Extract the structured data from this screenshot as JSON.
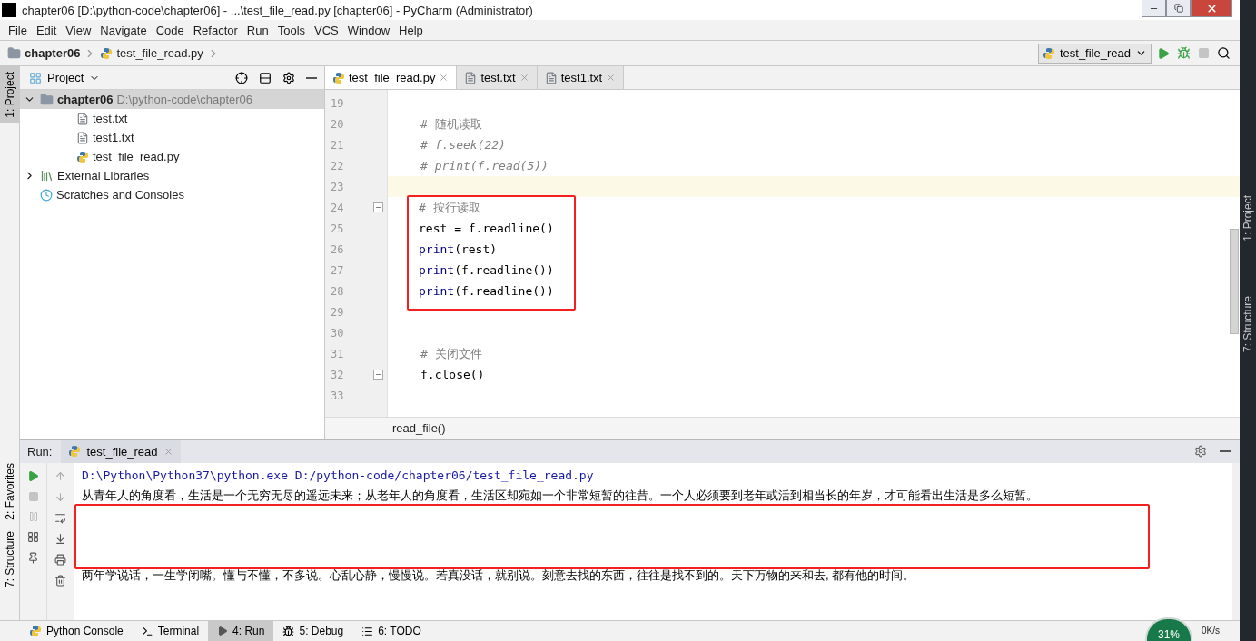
{
  "window": {
    "title": "chapter06 [D:\\python-code\\chapter06] - ...\\test_file_read.py [chapter06] - PyCharm (Administrator)"
  },
  "menu": [
    "File",
    "Edit",
    "View",
    "Navigate",
    "Code",
    "Refactor",
    "Run",
    "Tools",
    "VCS",
    "Window",
    "Help"
  ],
  "breadcrumb": {
    "folder": "chapter06",
    "file": "test_file_read.py"
  },
  "run_config": {
    "name": "test_file_read"
  },
  "left_tool_tabs": [
    {
      "label": "1: Project",
      "selected": true
    },
    {
      "label": "2: Favorites",
      "selected": false
    },
    {
      "label": "7: Structure",
      "selected": false
    }
  ],
  "project": {
    "title": "Project",
    "tree": [
      {
        "name": "chapter06",
        "path": "D:\\python-code\\chapter06",
        "kind": "folder",
        "expanded": true,
        "selected": true,
        "children": [
          {
            "name": "test.txt",
            "kind": "text",
            "selected": false
          },
          {
            "name": "test1.txt",
            "kind": "text",
            "selected": false
          },
          {
            "name": "test_file_read.py",
            "kind": "python",
            "selected": false
          }
        ]
      },
      {
        "name": "External Libraries",
        "kind": "library",
        "expanded": false,
        "selected": false
      },
      {
        "name": "Scratches and Consoles",
        "kind": "scratch",
        "selected": false
      }
    ]
  },
  "editor": {
    "tabs": [
      {
        "label": "test_file_read.py",
        "kind": "python",
        "selected": true
      },
      {
        "label": "test.txt",
        "kind": "text",
        "selected": false
      },
      {
        "label": "test1.txt",
        "kind": "text",
        "selected": false
      }
    ],
    "lines": [
      {
        "number": "19",
        "current": false,
        "fold": false,
        "boxed": false
      },
      {
        "number": "20",
        "current": false,
        "fold": false,
        "boxed": false,
        "tokens": [
          {
            "text": "# 随机读取",
            "kind": "comment"
          }
        ]
      },
      {
        "number": "21",
        "current": false,
        "fold": false,
        "boxed": false,
        "tokens": [
          {
            "text": "# f.seek(22)",
            "kind": "comment_italic"
          }
        ]
      },
      {
        "number": "22",
        "current": false,
        "fold": false,
        "boxed": false,
        "tokens": [
          {
            "text": "# print(f.read(5))",
            "kind": "comment_italic"
          }
        ]
      },
      {
        "number": "23",
        "current": true,
        "fold": false,
        "boxed": false
      },
      {
        "number": "24",
        "current": false,
        "fold": true,
        "boxed": true,
        "tokens": [
          {
            "text": "# 按行读取",
            "kind": "comment"
          }
        ]
      },
      {
        "number": "25",
        "current": false,
        "fold": false,
        "boxed": true,
        "tokens": [
          {
            "text": "rest = f.readline()",
            "kind": "plain"
          }
        ]
      },
      {
        "number": "26",
        "current": false,
        "fold": false,
        "boxed": true,
        "tokens": [
          {
            "text": "print",
            "kind": "builtin"
          },
          {
            "text": "(rest)",
            "kind": "plain"
          }
        ]
      },
      {
        "number": "27",
        "current": false,
        "fold": false,
        "boxed": true,
        "tokens": [
          {
            "text": "print",
            "kind": "builtin"
          },
          {
            "text": "(f.readline())",
            "kind": "plain"
          }
        ]
      },
      {
        "number": "28",
        "current": false,
        "fold": false,
        "boxed": true,
        "tokens": [
          {
            "text": "print",
            "kind": "builtin"
          },
          {
            "text": "(f.readline())",
            "kind": "plain"
          }
        ]
      },
      {
        "number": "29",
        "current": false,
        "fold": false,
        "boxed": false
      },
      {
        "number": "30",
        "current": false,
        "fold": false,
        "boxed": false
      },
      {
        "number": "31",
        "current": false,
        "fold": false,
        "boxed": false,
        "tokens": [
          {
            "text": "# 关闭文件",
            "kind": "comment"
          }
        ]
      },
      {
        "number": "32",
        "current": false,
        "fold": true,
        "boxed": false,
        "tokens": [
          {
            "text": "f.close()",
            "kind": "plain"
          }
        ]
      },
      {
        "number": "33",
        "current": false,
        "fold": false,
        "boxed": false
      }
    ],
    "breadcrumb": "read_file()"
  },
  "run": {
    "label": "Run:",
    "tab": "test_file_read",
    "console": [
      {
        "kind": "command",
        "text": "D:\\Python\\Python37\\python.exe D:/python-code/chapter06/test_file_read.py"
      },
      {
        "kind": "output",
        "text": "从青年人的角度看，生活是一个无穷无尽的遥远未来；从老年人的角度看，生活区却宛如一个非常短暂的往昔。一个人必须要到老年或活到相当长的年岁，才可能看出生活是多么短暂。"
      },
      {
        "kind": "redacted"
      },
      {
        "kind": "output",
        "text": "两年学说话，一生学闭嘴。懂与不懂，不多说。心乱心静，慢慢说。若真没话，就别说。刻意去找的东西，往往是找不到的。天下万物的来和去, 都有他的时间。"
      }
    ]
  },
  "bottom_tabs": [
    {
      "label": "Python Console",
      "kind": "python",
      "selected": false
    },
    {
      "label": "Terminal",
      "kind": "terminal",
      "selected": false
    },
    {
      "label": "4: Run",
      "kind": "run",
      "selected": true
    },
    {
      "label": "5: Debug",
      "kind": "debug",
      "selected": false
    },
    {
      "label": "6: TODO",
      "kind": "todo",
      "selected": false
    }
  ],
  "net_widget": {
    "percent": "31%",
    "speed": "0K/s"
  },
  "background_window": {
    "tabs": [
      "1: Project",
      "7: Structure"
    ]
  }
}
